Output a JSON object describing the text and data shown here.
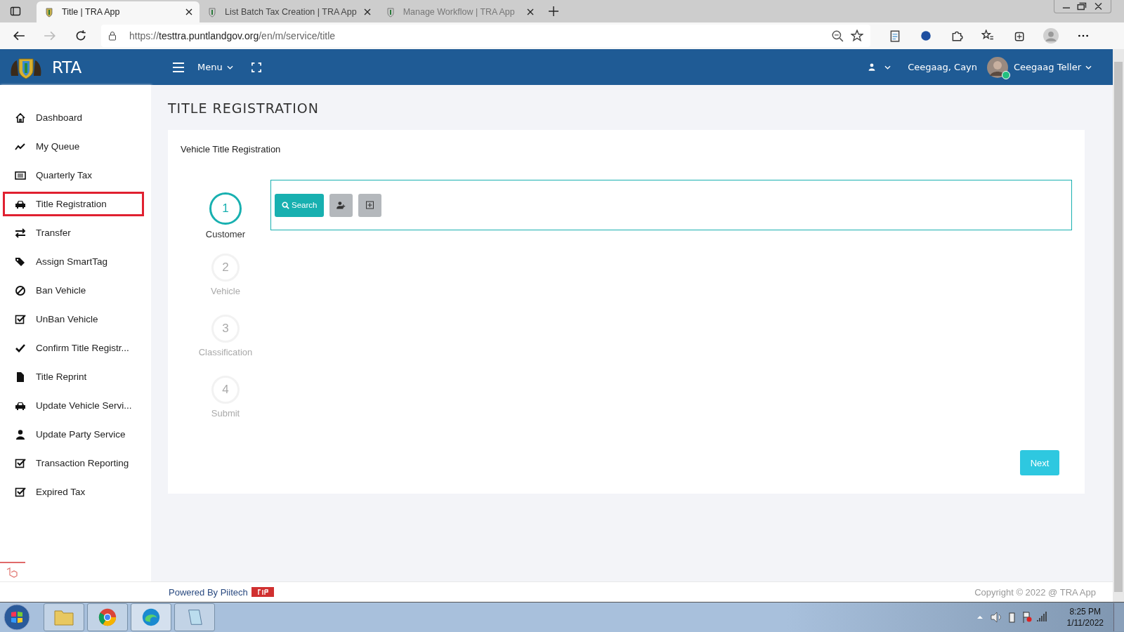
{
  "browser": {
    "tabs": [
      {
        "title": "Title | TRA App",
        "selected": true
      },
      {
        "title": "List Batch Tax Creation | TRA App",
        "selected": false
      },
      {
        "title": "Manage Workflow | TRA App",
        "selected": false
      }
    ],
    "url": {
      "scheme": "https://",
      "host": "testtra.puntlandgov.org",
      "path": "/en/m/service/title"
    }
  },
  "header": {
    "brand": "RTA",
    "menu": "Menu",
    "user_short": "Ceegaag, Cayn",
    "user_role": "Ceegaag Teller",
    "online": true
  },
  "sidebar": {
    "items": [
      {
        "label": "Dashboard",
        "kind": "home",
        "selected": false
      },
      {
        "label": "My Queue",
        "kind": "trend",
        "selected": false
      },
      {
        "label": "Quarterly Tax",
        "kind": "list",
        "selected": false
      },
      {
        "label": "Title Registration",
        "kind": "car",
        "selected": true
      },
      {
        "label": "Transfer",
        "kind": "swap",
        "selected": false
      },
      {
        "label": "Assign SmartTag",
        "kind": "tags",
        "selected": false
      },
      {
        "label": "Ban Vehicle",
        "kind": "ban",
        "selected": false
      },
      {
        "label": "UnBan Vehicle",
        "kind": "checkbox",
        "selected": false
      },
      {
        "label": "Confirm Title Registr...",
        "kind": "check",
        "selected": false
      },
      {
        "label": "Title Reprint",
        "kind": "file",
        "selected": false
      },
      {
        "label": "Update Vehicle Servi...",
        "kind": "car",
        "selected": false
      },
      {
        "label": "Update Party Service",
        "kind": "user",
        "selected": false
      },
      {
        "label": "Transaction Reporting",
        "kind": "checkbox",
        "selected": false
      },
      {
        "label": "Expired Tax",
        "kind": "checkbox",
        "selected": false
      }
    ]
  },
  "page": {
    "title": "TITLE REGISTRATION",
    "card_title": "Vehicle Title Registration",
    "steps": [
      {
        "number": "1",
        "label": "Customer",
        "selected": true
      },
      {
        "number": "2",
        "label": "Vehicle",
        "selected": false
      },
      {
        "number": "3",
        "label": "Classification",
        "selected": false
      },
      {
        "number": "4",
        "label": "Submit",
        "selected": false
      }
    ],
    "search_button": "Search",
    "next_button": "Next"
  },
  "footer": {
    "powered_by": "Powered By Piitech",
    "copyright": "Copyright © 2022 @ TRA App"
  },
  "taskbar": {
    "time": "8:25 PM",
    "date": "1/11/2022"
  }
}
